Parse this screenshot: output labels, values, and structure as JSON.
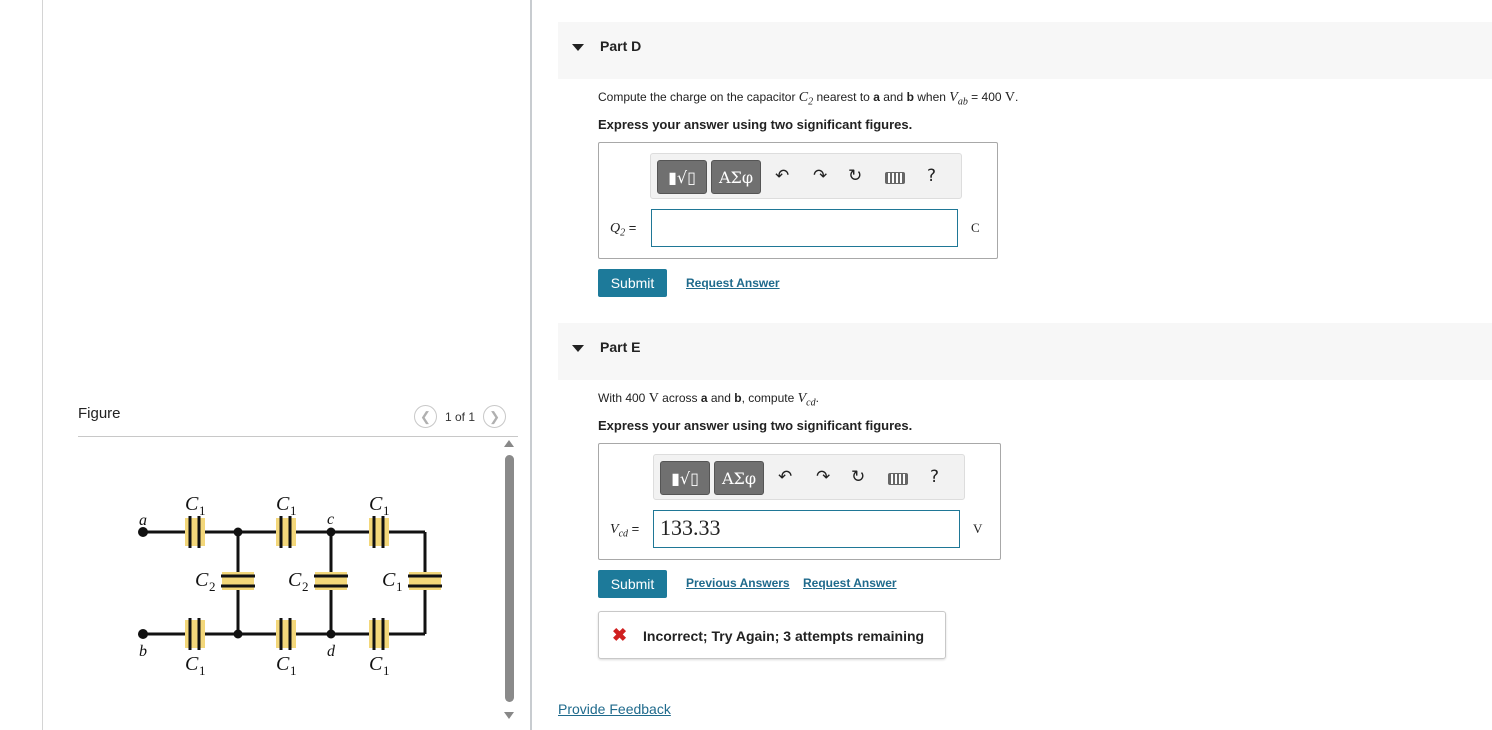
{
  "figure": {
    "title": "Figure",
    "counter": "1 of 1",
    "prev_icon": "chevron-left-icon",
    "next_icon": "chevron-right-icon",
    "circuit_labels": {
      "node_a": "a",
      "node_b": "b",
      "node_c": "c",
      "node_d": "d",
      "cap_symbol": "C",
      "sub_1": "1",
      "sub_2": "2"
    }
  },
  "toolbar": {
    "template_label": "▮√▯",
    "greek_label": "ΑΣφ",
    "undo_icon": "↶",
    "redo_icon": "↷",
    "reset_icon": "↻",
    "keyboard_icon": "keyboard-icon",
    "help_label": "?"
  },
  "partD": {
    "title": "Part D",
    "q_pre": "Compute the charge on the capacitor ",
    "q_cap": "C",
    "q_cap_sub": "2",
    "q_mid1": " nearest to ",
    "q_a": "a",
    "q_and": " and ",
    "q_b": "b",
    "q_when": " when ",
    "q_V": "V",
    "q_V_sub": "ab",
    "q_eq": " = 400 ",
    "q_unit": "V",
    "q_end": ".",
    "instruction": "Express your answer using two significant figures.",
    "answer_var": "Q",
    "answer_var_sub": "2",
    "answer_eq": " =",
    "answer_value": "",
    "unit": "C",
    "submit": "Submit",
    "request_answer": "Request Answer"
  },
  "partE": {
    "title": "Part E",
    "q_pre": "With 400 ",
    "q_unit": "V",
    "q_mid": " across ",
    "q_a": "a",
    "q_and": " and ",
    "q_b": "b",
    "q_comp": ", compute ",
    "q_V": "V",
    "q_V_sub": "cd",
    "q_end": ".",
    "instruction": "Express your answer using two significant figures.",
    "answer_var": "V",
    "answer_var_sub": "cd",
    "answer_eq": " =",
    "answer_value": "133.33",
    "unit": "V",
    "submit": "Submit",
    "previous_answers": "Previous Answers",
    "request_answer": "Request Answer",
    "feedback_icon": "x-mark-icon",
    "feedback": "Incorrect; Try Again; 3 attempts remaining"
  },
  "footer": {
    "provide_feedback": "Provide Feedback"
  },
  "colors": {
    "accent": "#1d7a9a",
    "link": "#1f6a8c",
    "error": "#d02020",
    "capacitor_highlight": "#f3d77a"
  }
}
